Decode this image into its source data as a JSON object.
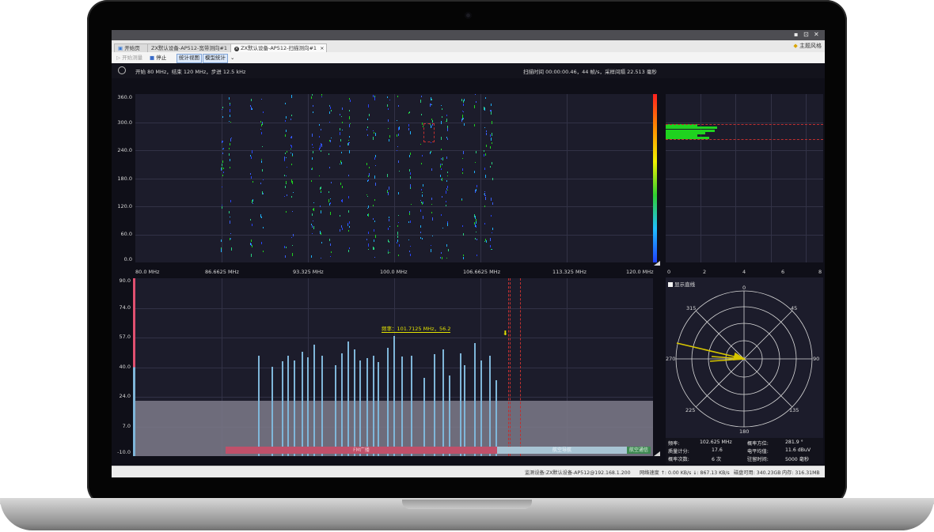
{
  "window": {
    "minimize": "▪",
    "restore": "⊡",
    "close": "✕",
    "theme_label": "主题风格"
  },
  "tabs": [
    {
      "label": "开始页",
      "active": false
    },
    {
      "label": "ZX默认设备-AP512-宽带测向#1",
      "active": false
    },
    {
      "label": "ZX默认设备-AP512-扫描测向#1",
      "active": true
    }
  ],
  "toolbar": {
    "start_label": "开始测量",
    "stop_label": "停止",
    "stat_view_label": "统计视图",
    "level_stat_label": "模型统计"
  },
  "status": {
    "scan_params": "开始 80 MHz，结束 120 MHz，步进 12.5 kHz",
    "scan_time": "扫描时间 00:00:00.46，44 帧/s，采样间隔 22.513 毫秒"
  },
  "waterfall": {
    "yticks": [
      "360.0",
      "300.0",
      "240.0",
      "180.0",
      "120.0",
      "60.0",
      "0.0"
    ],
    "xticks": [
      "80.0 MHz",
      "86.6625 MHz",
      "93.325 MHz",
      "100.0 MHz",
      "106.6625 MHz",
      "113.325 MHz",
      "120.0 MHz"
    ]
  },
  "histogram": {
    "xticks": [
      "0",
      "2",
      "4",
      "6",
      "8"
    ]
  },
  "spectrum": {
    "yticks": [
      "90.0",
      "74.0",
      "57.0",
      "40.0",
      "24.0",
      "7.0",
      "-10.0"
    ],
    "marker_label": "频率：101.7125 MHz，56.2",
    "band_labels": {
      "fm": "FM广播",
      "aero": "航空导航",
      "aero2": "航空通信"
    }
  },
  "polar": {
    "show_line_label": "显示直线",
    "angles": {
      "a0": "0",
      "a45": "45",
      "a90": "90",
      "a135": "135",
      "a180": "180",
      "a225": "225",
      "a270": "270",
      "a315": "315"
    }
  },
  "info": {
    "freq_label": "频率:",
    "freq_value": "102.625 MHz",
    "bearing_label": "概率方位:",
    "bearing_value": "281.9 °",
    "quality_label": "质量计分:",
    "quality_value": "17.6",
    "level_label": "电平均值:",
    "level_value": "11.6 dBuV",
    "count_label": "概率次数:",
    "count_value": "6 次",
    "hold_label": "驻留时间:",
    "hold_value": "5000 毫秒"
  },
  "statusbar": {
    "device": "监测设备:ZX默认设备-AP512@192.168.1.200",
    "net": "网络速度 ↑: 0.00 KB/s ↓: 867.13 KB/s",
    "disk": "磁盘可用: 340.23GB",
    "memory": "内存: 316.31MB"
  },
  "colors": {
    "panel_bg": "#1c1c2b",
    "spectrum_bar": "#7fb6d9",
    "noise_floor": "#7d7a8a",
    "marker": "#d4d400",
    "fm_band": "#c0506a",
    "aero_band": "#a8c4d4",
    "histogram_bar": "#1fd21f",
    "arrow": "#d7c600"
  }
}
